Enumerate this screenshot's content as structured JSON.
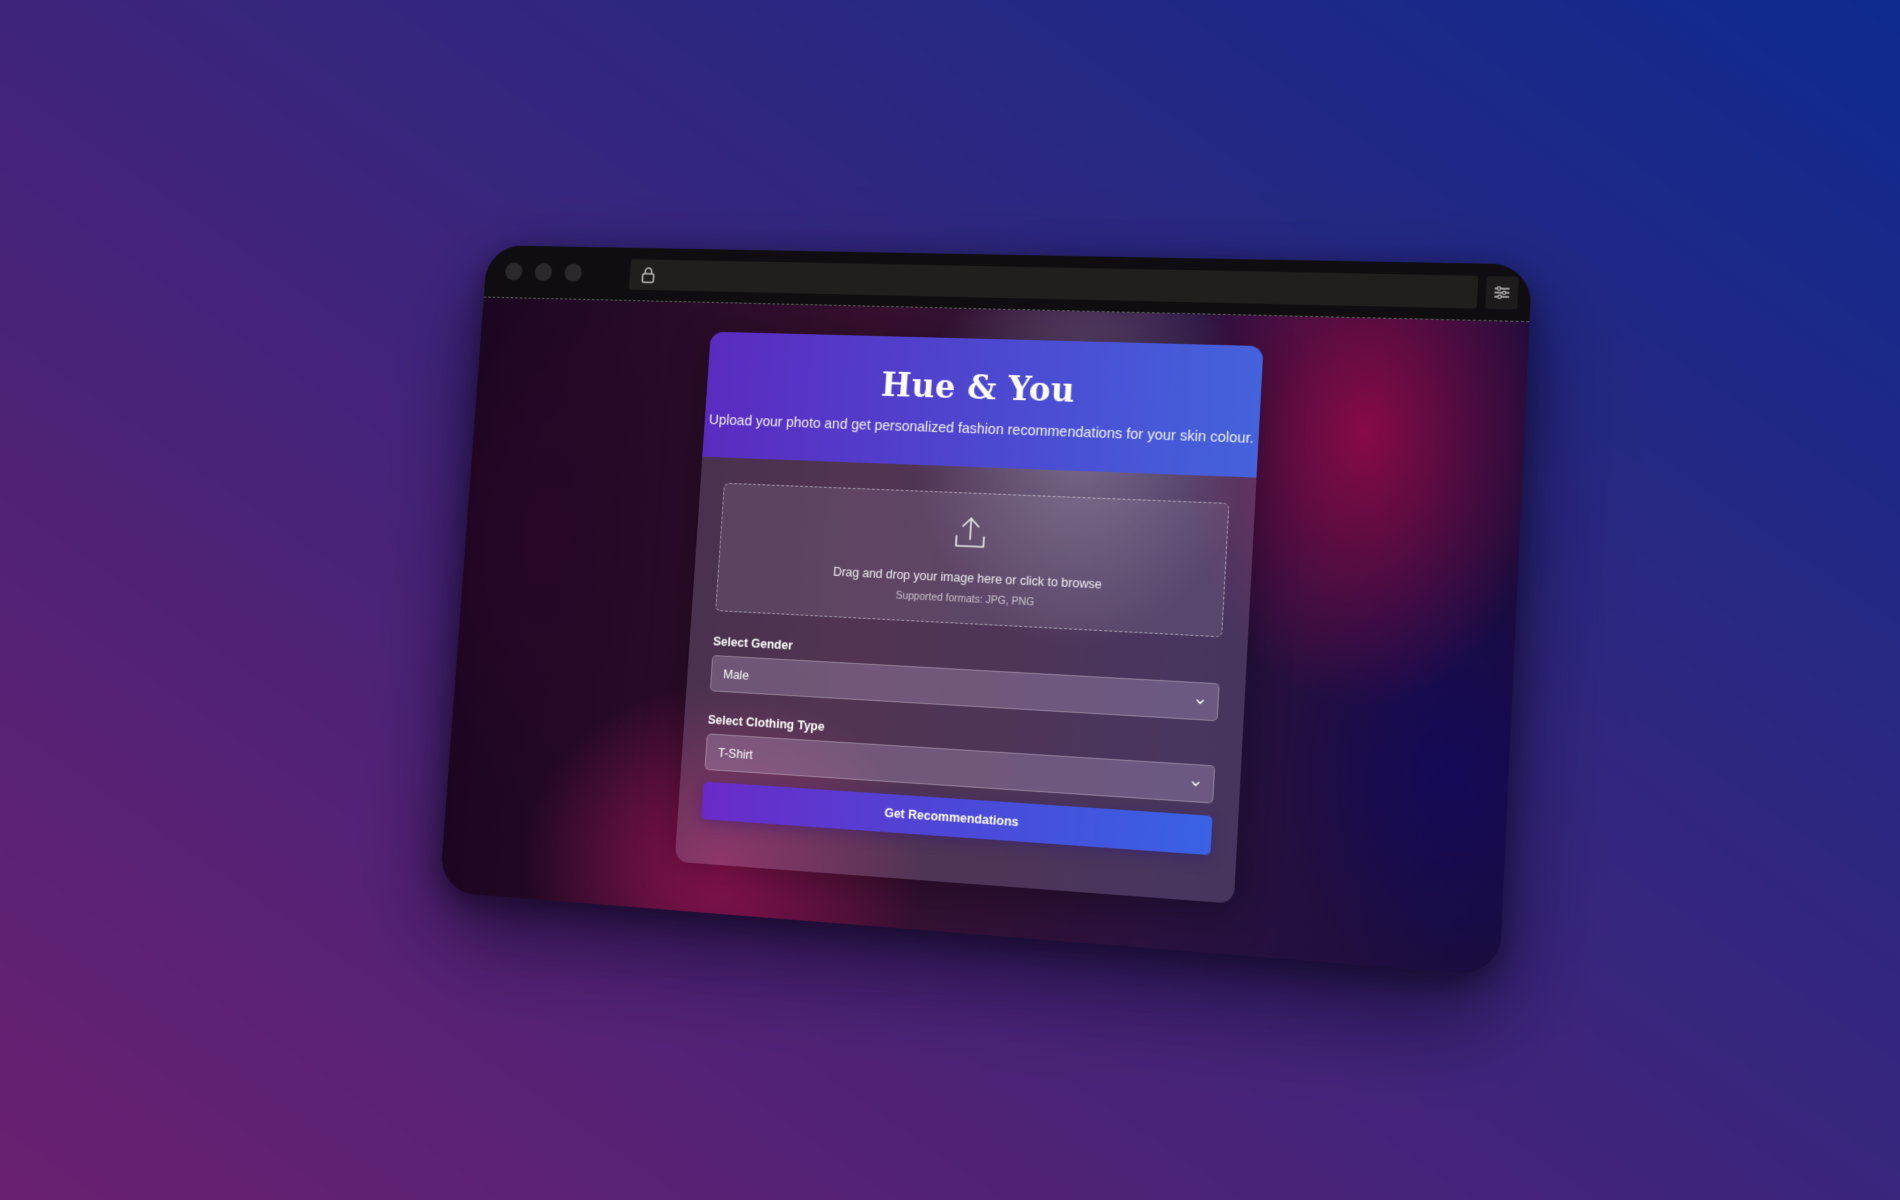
{
  "app": {
    "title": "Hue & You",
    "subtitle": "Upload your photo and get personalized fashion recommendations for your skin colour."
  },
  "upload": {
    "text": "Drag and drop your image here or click to browse",
    "formats": "Supported formats: JPG, PNG",
    "icon": "upload-icon"
  },
  "form": {
    "gender": {
      "label": "Select Gender",
      "value": "Male"
    },
    "clothing": {
      "label": "Select Clothing Type",
      "value": "T-Shirt"
    },
    "submit_label": "Get Recommendations"
  },
  "browser": {
    "icons": [
      "lock-icon",
      "settings-icon",
      "chevron-down-icon"
    ]
  },
  "colors": {
    "header_gradient_start": "#5b2bc0",
    "header_gradient_end": "#4462dc",
    "button_gradient_start": "#6a2ac8",
    "button_gradient_end": "#3962e4",
    "background_top_right": "#0e2a8e",
    "background_bottom_left": "#6a2070"
  }
}
